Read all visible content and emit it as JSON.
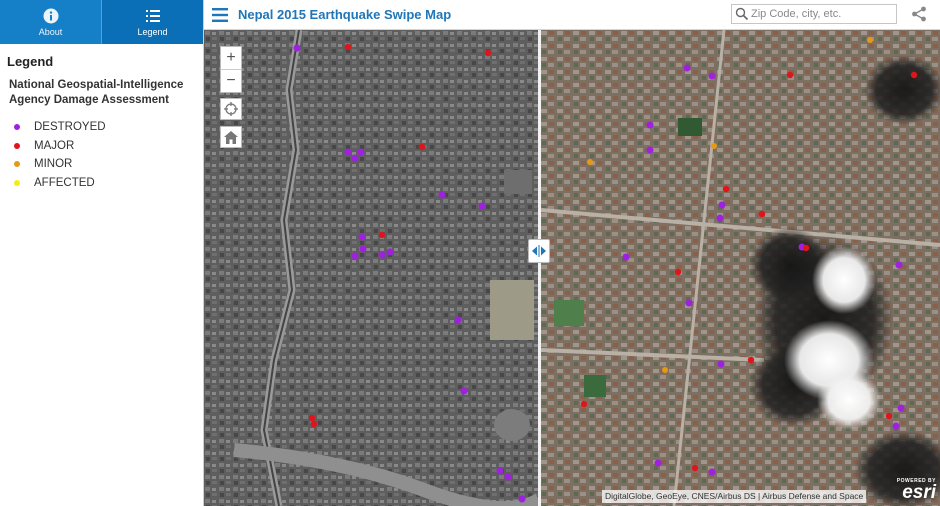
{
  "sidebar": {
    "tabs": [
      {
        "label": "About",
        "icon": "info-icon"
      },
      {
        "label": "Legend",
        "icon": "list-icon"
      }
    ],
    "legend_title": "Legend",
    "legend_subtitle": "National Geospatial-Intelligence Agency Damage Assessment",
    "items": [
      {
        "label": "DESTROYED",
        "color": "#a020e0"
      },
      {
        "label": "MAJOR",
        "color": "#e0141a"
      },
      {
        "label": "MINOR",
        "color": "#e59a16"
      },
      {
        "label": "AFFECTED",
        "color": "#f2ee12"
      }
    ]
  },
  "header": {
    "title": "Nepal 2015 Earthquake Swipe Map",
    "search_placeholder": "Zip Code, city, etc."
  },
  "map": {
    "zoom_in": "+",
    "zoom_out": "−",
    "attribution": "DigitalGlobe, GeoEye, CNES/Airbus DS | Airbus Defense and Space",
    "esri_powered": "POWERED BY",
    "esri_name": "esri"
  }
}
